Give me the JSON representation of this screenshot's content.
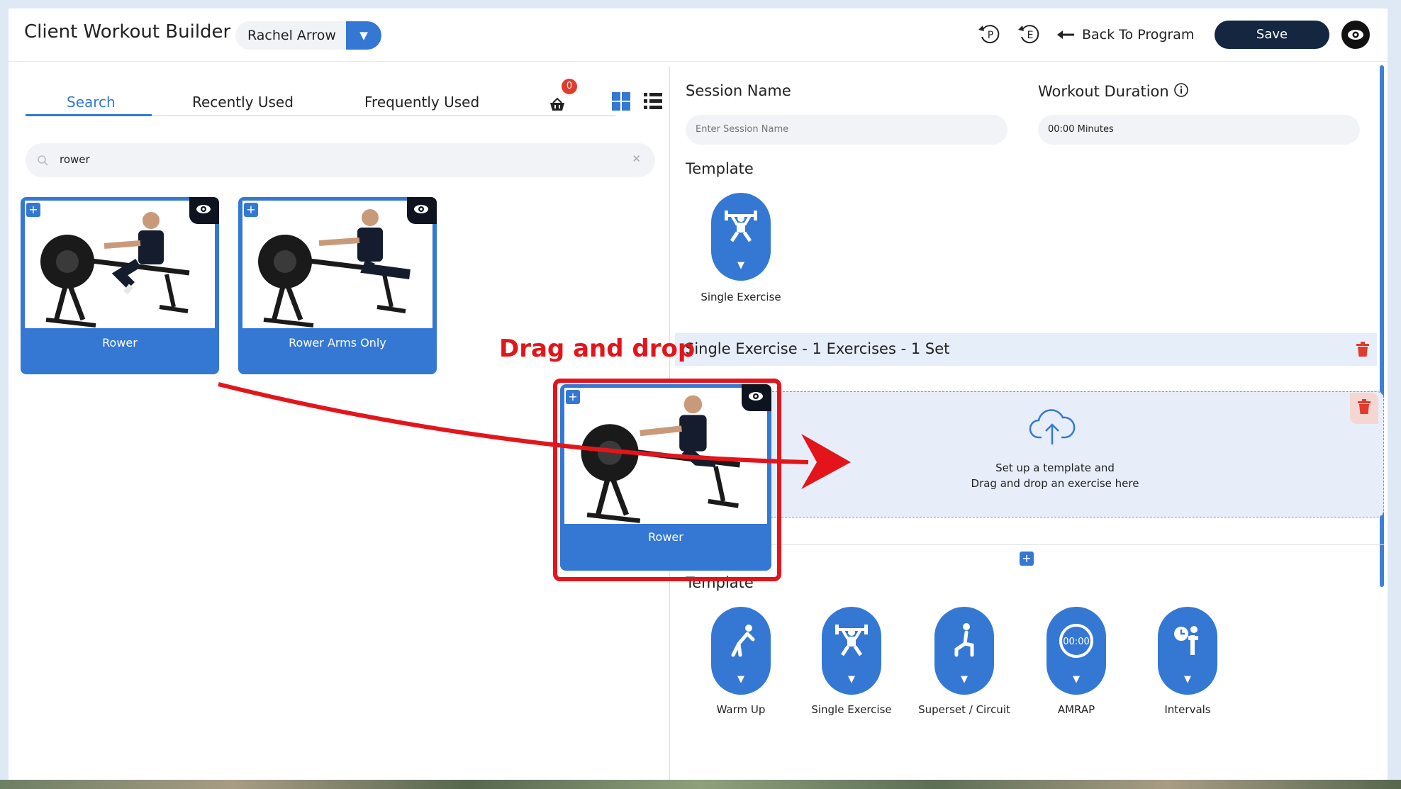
{
  "header": {
    "title": "Client Workout Builder :",
    "client_name": "Rachel Arrow",
    "icons": {
      "p_label": "P",
      "e_label": "E"
    },
    "back_label": "Back To Program",
    "save_label": "Save"
  },
  "library": {
    "tabs": [
      "Search",
      "Recently Used",
      "Frequently Used"
    ],
    "active_tab": "Search",
    "cart_count": "0",
    "search_value": "rower",
    "cards": [
      {
        "label": "Rower"
      },
      {
        "label": "Rower Arms Only"
      }
    ]
  },
  "builder": {
    "session_name_label": "Session Name",
    "session_name_placeholder": "Enter Session Name",
    "duration_label": "Workout Duration",
    "duration_value": "00:00 Minutes",
    "template_label": "Template",
    "selected_template": "Single Exercise",
    "session_header": "Single Exercise - 1 Exercises - 1 Set",
    "dropzone_line1": "Set up a template and",
    "dropzone_line2": "Drag and drop an exercise here",
    "templates": [
      {
        "label": "Warm Up",
        "icon": "stretch-icon"
      },
      {
        "label": "Single Exercise",
        "icon": "weightlifter-icon"
      },
      {
        "label": "Superset / Circuit",
        "icon": "lunge-icon"
      },
      {
        "label": "AMRAP",
        "icon": "timer-icon",
        "timer_text": "00:00"
      },
      {
        "label": "Intervals",
        "icon": "stopwatch-icon"
      }
    ]
  },
  "annotation": {
    "text": "Drag and drop",
    "dragged_card_label": "Rower",
    "color": "#e3151b"
  },
  "colors": {
    "accent": "#3478d4",
    "dark": "#142640",
    "danger": "#e03b2c"
  }
}
